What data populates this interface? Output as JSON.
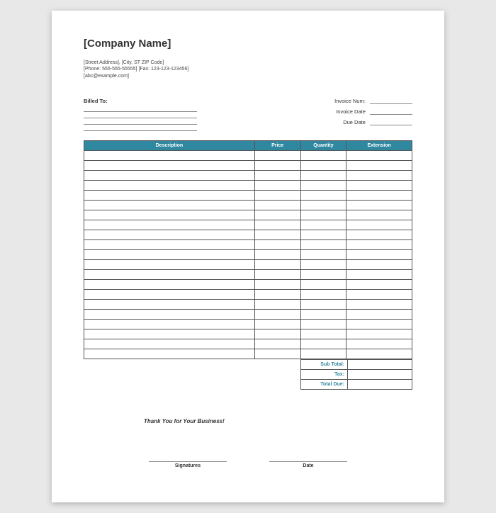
{
  "company": {
    "name": "[Company Name]",
    "address_line1": "[Street Address], [City, ST ZIP Code]",
    "address_line2": "[Phone: 555-555-55555] [Fax: 123-123-123456]",
    "address_line3": "[abc@example.com]"
  },
  "labels": {
    "billed_to": "Billed To:",
    "invoice_num": "Invoice Num:",
    "invoice_date": "Invoice Date",
    "due_date": "Due Date"
  },
  "table": {
    "headers": {
      "description": "Description",
      "price": "Price",
      "quantity": "Quantity",
      "extension": "Extension"
    },
    "row_count": 21
  },
  "totals": {
    "subtotal": "Sub Total:",
    "tax": "Tax:",
    "total_due": "Total Due:"
  },
  "footer": {
    "thank_you": "Thank You for Your Business!",
    "signatures": "Signatures",
    "date": "Date"
  }
}
